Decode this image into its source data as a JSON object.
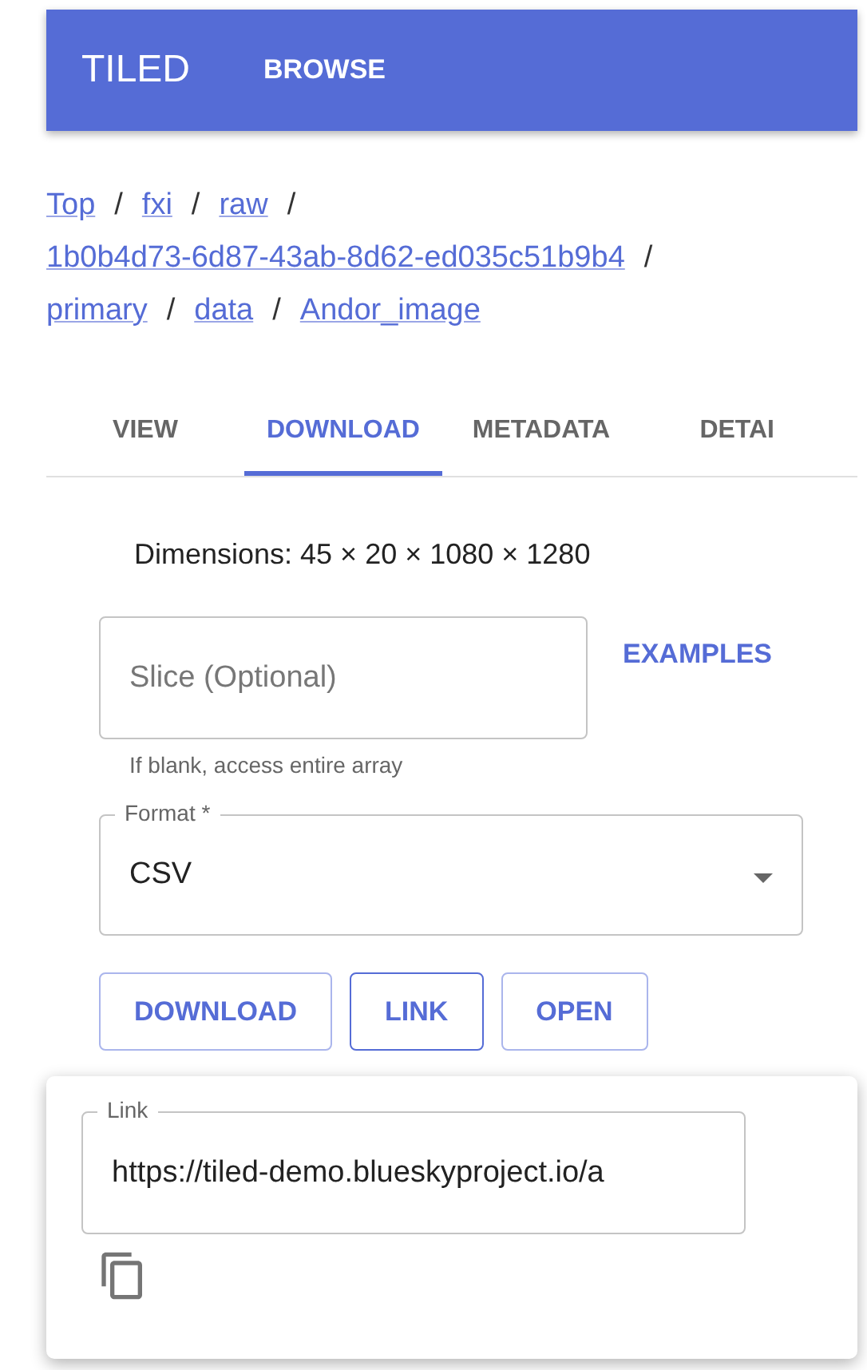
{
  "app_bar": {
    "title": "TILED",
    "nav": [
      {
        "label": "BROWSE"
      }
    ]
  },
  "breadcrumbs": [
    {
      "label": "Top"
    },
    {
      "label": "fxi"
    },
    {
      "label": "raw"
    },
    {
      "label": "1b0b4d73-6d87-43ab-8d62-ed035c51b9b4"
    },
    {
      "label": "primary"
    },
    {
      "label": "data"
    },
    {
      "label": "Andor_image"
    }
  ],
  "breadcrumb_separator": "/",
  "tabs": [
    {
      "label": "VIEW",
      "selected": false
    },
    {
      "label": "DOWNLOAD",
      "selected": true
    },
    {
      "label": "METADATA",
      "selected": false
    },
    {
      "label": "DETAI",
      "selected": false
    }
  ],
  "dimensions": "Dimensions: 45 × 20 × 1080 × 1280",
  "slice_field": {
    "placeholder": "Slice (Optional)",
    "helper": "If blank, access entire array"
  },
  "examples_button": "EXAMPLES",
  "format_select": {
    "label": "Format *",
    "value": "CSV"
  },
  "buttons": [
    {
      "label": "DOWNLOAD",
      "selected": false
    },
    {
      "label": "LINK",
      "selected": true
    },
    {
      "label": "OPEN",
      "selected": false
    }
  ],
  "link_popover": {
    "label": "Link",
    "value": "https://tiled-demo.blueskyproject.io/a"
  }
}
